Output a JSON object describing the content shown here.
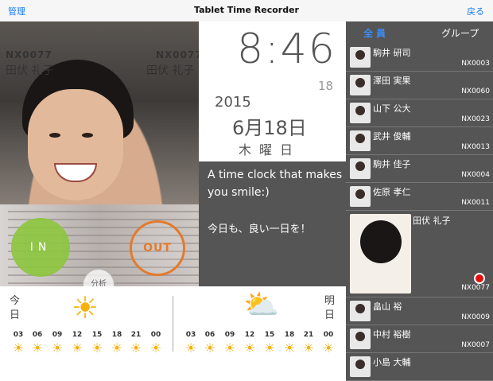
{
  "topbar": {
    "left": "管理",
    "title": "Tablet Time Recorder",
    "right": "戻る"
  },
  "camera": {
    "employee_id": "NX0077",
    "employee_name": "田伏 礼子",
    "in_label": "IN",
    "out_label": "OUT",
    "analyze_label": "分析"
  },
  "clock": {
    "time": "8:46",
    "seconds": "18",
    "year": "2015",
    "date": "6月18日",
    "weekday": "木曜日"
  },
  "message": {
    "line1": "A time clock that makes you smile:)",
    "line2": "今日も、良い一日を！"
  },
  "weather": {
    "today_label": "今日",
    "tomorrow_label": "明日",
    "today_icon": "sun-icon",
    "tomorrow_icon": "partly-cloudy-icon",
    "hours": [
      "03",
      "06",
      "09",
      "12",
      "15",
      "18",
      "21",
      "00"
    ]
  },
  "sidebar": {
    "tab_all": "全員",
    "tab_group": "グループ",
    "employees": [
      {
        "name": "駒井 研司",
        "id": "NX0003"
      },
      {
        "name": "澤田 実果",
        "id": "NX0060"
      },
      {
        "name": "山下 公大",
        "id": "NX0023"
      },
      {
        "name": "武井 俊輔",
        "id": "NX0013"
      },
      {
        "name": "駒井 佳子",
        "id": "NX0004"
      },
      {
        "name": "佐原 孝仁",
        "id": "NX0011"
      },
      {
        "name": "田伏 礼子",
        "id": "NX0077"
      },
      {
        "name": "畠山 裕",
        "id": "NX0009"
      },
      {
        "name": "中村 裕樹",
        "id": "NX0007"
      },
      {
        "name": "小島 大輔",
        "id": ""
      }
    ]
  },
  "colors": {
    "in": "#8dc540",
    "out": "#e27b2e",
    "accent": "#1a7cf5",
    "sun": "#f6b10b",
    "status": "#e01010"
  }
}
